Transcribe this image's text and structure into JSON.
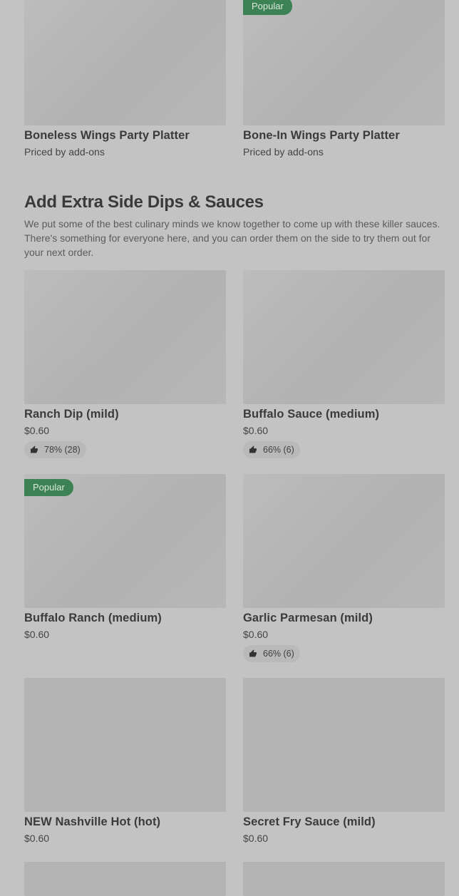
{
  "platters": [
    {
      "name": "Boneless Wings Party Platter",
      "price": "Priced by add-ons",
      "badge": ""
    },
    {
      "name": "Bone-In Wings Party Platter",
      "price": "Priced by add-ons",
      "badge": "Popular"
    }
  ],
  "section": {
    "title": "Add Extra Side Dips & Sauces",
    "description": "We put some of the best culinary minds we know together to come up with these killer sauces. There's something for everyone here, and you can order them on the side to try them out for your next order."
  },
  "items": [
    {
      "name": "Ranch Dip (mild)",
      "price": "$0.60",
      "rating": "78% (28)",
      "badge": ""
    },
    {
      "name": "Buffalo Sauce (medium)",
      "price": "$0.60",
      "rating": "66% (6)",
      "badge": ""
    },
    {
      "name": "Buffalo Ranch (medium)",
      "price": "$0.60",
      "rating": "",
      "badge": "Popular"
    },
    {
      "name": "Garlic Parmesan (mild)",
      "price": "$0.60",
      "rating": "66% (6)",
      "badge": ""
    },
    {
      "name": "NEW Nashville Hot (hot)",
      "price": "$0.60",
      "rating": "",
      "badge": ""
    },
    {
      "name": "Secret Fry Sauce (mild)",
      "price": "$0.60",
      "rating": "",
      "badge": ""
    }
  ],
  "icons": {
    "rating": "thumbs-up-icon"
  },
  "colors": {
    "background": "#c3c3c3",
    "badge": "#3d8254",
    "placeholder": "#b6b6b6"
  }
}
